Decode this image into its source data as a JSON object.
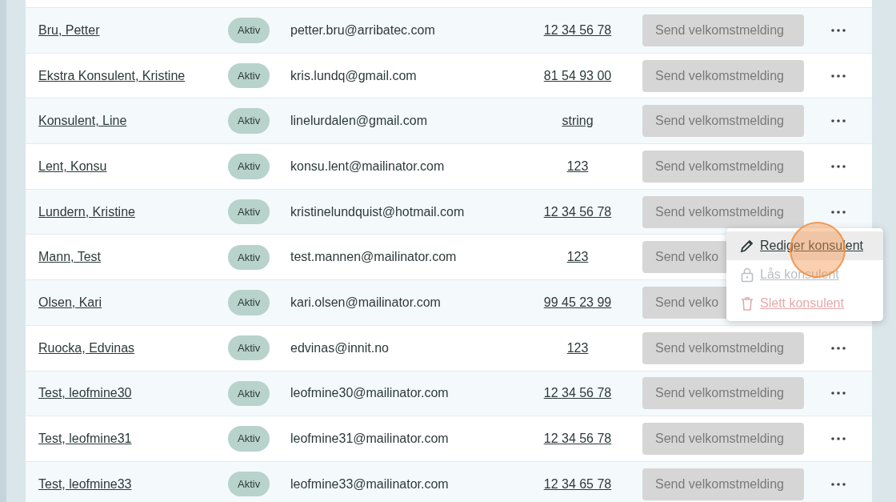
{
  "rows": [
    {
      "name": "Bru, Petter",
      "status": "Aktiv",
      "email": "petter.bru@arribatec.com",
      "phone": "12 34 56 78",
      "action": "Send velkomstmelding"
    },
    {
      "name": "Ekstra Konsulent, Kristine",
      "status": "Aktiv",
      "email": "kris.lundq@gmail.com",
      "phone": "81 54 93 00",
      "action": "Send velkomstmelding"
    },
    {
      "name": "Konsulent, Line",
      "status": "Aktiv",
      "email": "linelurdalen@gmail.com",
      "phone": "string",
      "action": "Send velkomstmelding"
    },
    {
      "name": "Lent, Konsu",
      "status": "Aktiv",
      "email": "konsu.lent@mailinator.com",
      "phone": "123",
      "action": "Send velkomstmelding"
    },
    {
      "name": "Lundern, Kristine",
      "status": "Aktiv",
      "email": "kristinelundquist@hotmail.com",
      "phone": "12 34 56 78",
      "action": "Send velkomstmelding"
    },
    {
      "name": "Mann, Test",
      "status": "Aktiv",
      "email": "test.mannen@mailinator.com",
      "phone": "123",
      "action": "Send velko"
    },
    {
      "name": "Olsen, Kari",
      "status": "Aktiv",
      "email": "kari.olsen@mailinator.com",
      "phone": "99 45 23 99",
      "action": "Send velko"
    },
    {
      "name": "Ruocka, Edvinas",
      "status": "Aktiv",
      "email": "edvinas@innit.no",
      "phone": "123",
      "action": "Send velkomstmelding"
    },
    {
      "name": "Test, leofmine30",
      "status": "Aktiv",
      "email": "leofmine30@mailinator.com",
      "phone": "12 34 56 78",
      "action": "Send velkomstmelding"
    },
    {
      "name": "Test, leofmine31",
      "status": "Aktiv",
      "email": "leofmine31@mailinator.com",
      "phone": "12 34 56 78",
      "action": "Send velkomstmelding"
    },
    {
      "name": "Test, leofmine33",
      "status": "Aktiv",
      "email": "leofmine33@mailinator.com",
      "phone": "12 34 65 78",
      "action": "Send velkomstmelding"
    }
  ],
  "menu": {
    "items": [
      {
        "kind": "edit",
        "label": "Rediger konsulent",
        "selected": true,
        "disabled": false
      },
      {
        "kind": "lock",
        "label": "Lås konsulent",
        "selected": false,
        "disabled": true
      },
      {
        "kind": "delete",
        "label": "Slett konsulent",
        "selected": false,
        "disabled": true
      }
    ]
  }
}
